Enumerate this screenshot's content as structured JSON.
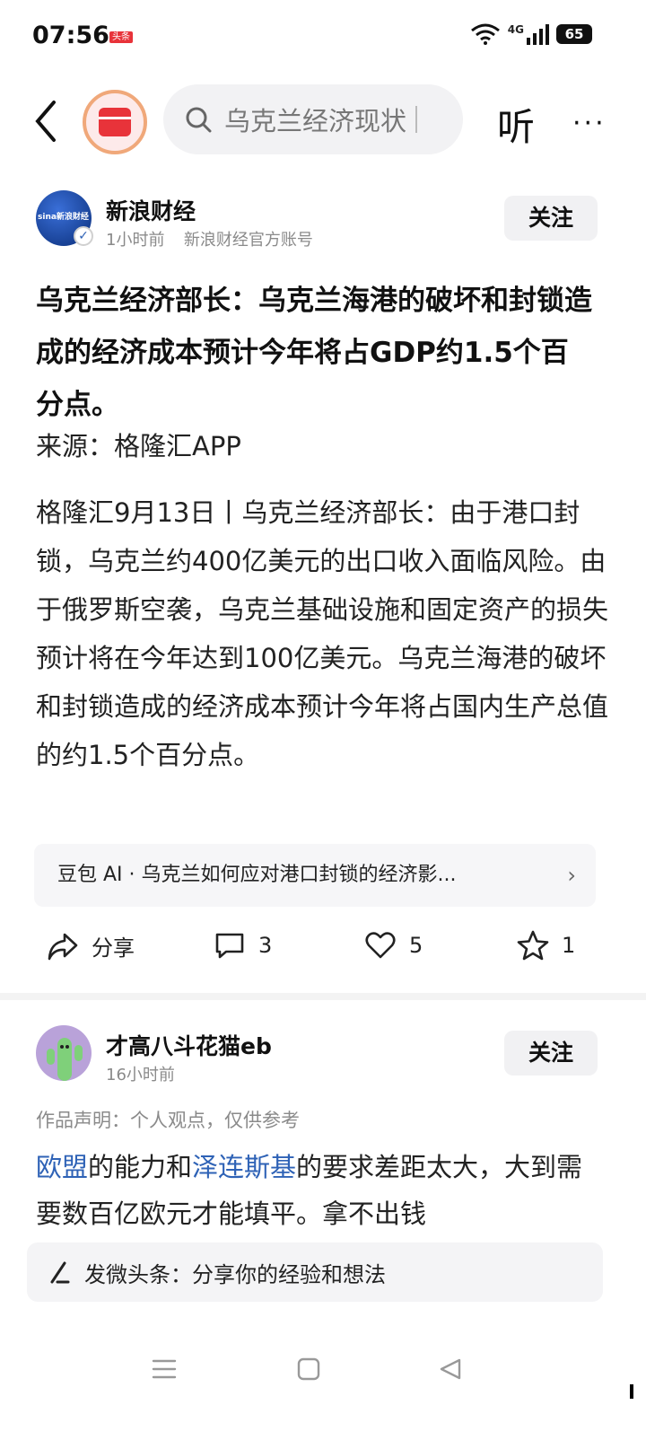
{
  "status_bar": {
    "time": "07:56",
    "app_badge": "头条",
    "network": "4G",
    "battery": "65"
  },
  "nav": {
    "search_placeholder": "乌克兰经济现状",
    "listen_label": "听",
    "more_label": "···"
  },
  "post": {
    "author": {
      "name": "新浪财经",
      "avatar_text": "sina新浪财经",
      "time": "1小时前",
      "account": "新浪财经官方账号",
      "follow_label": "关注"
    },
    "title": "乌克兰经济部长：乌克兰海港的破坏和封锁造成的经济成本预计今年将占GDP约1.5个百分点。",
    "source": "来源：格隆汇APP",
    "body": "格隆汇9月13日丨乌克兰经济部长：由于港口封锁，乌克兰约400亿美元的出口收入面临风险。由于俄罗斯空袭，乌克兰基础设施和固定资产的损失预计将在今年达到100亿美元。乌克兰海港的破坏和封锁造成的经济成本预计今年将占国内生产总值的约1.5个百分点。",
    "ai_prompt": "豆包 AI · 乌克兰如何应对港口封锁的经济影...",
    "actions": {
      "share_label": "分享",
      "comments": "3",
      "likes": "5",
      "favorites": "1"
    }
  },
  "comment": {
    "author": {
      "name": "才高八斗花猫eb",
      "time": "16小时前",
      "follow_label": "关注"
    },
    "declaration": "作品声明：个人观点，仅供参考",
    "link1": "欧盟",
    "text1": "的能力和",
    "link2": "泽连斯基",
    "text2": "的要求差距太大，大到需要数百亿欧元才能填平。拿不出钱"
  },
  "compose": {
    "placeholder": "发微头条：分享你的经验和想法"
  },
  "colors": {
    "link": "#2e62b6",
    "brand_red": "#e8333a",
    "follow_bg": "#f1f1f3"
  }
}
